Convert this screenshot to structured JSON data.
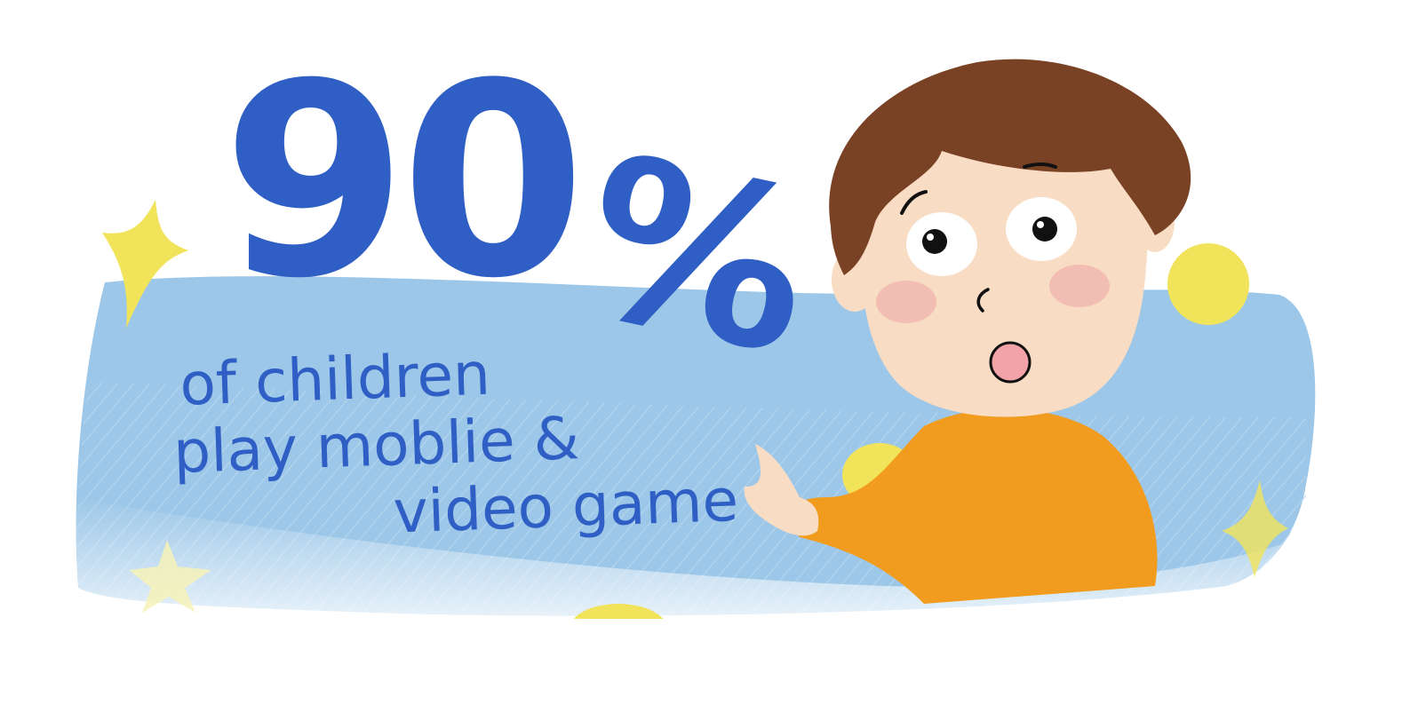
{
  "headline": {
    "value": "90",
    "symbol": "%"
  },
  "caption": {
    "line1": "of children",
    "line2": "play moblie &",
    "line3": "video game"
  },
  "colors": {
    "text": "#2f5fc4",
    "banner": "#9cc7e8",
    "hair": "#7a4224",
    "skin": "#f8dcc4",
    "cheek": "#f1b9b0",
    "shirt": "#f19c1f",
    "sparkle": "#f1e45a",
    "mouth": "#f1a3a8"
  },
  "icons": [
    "sparkle-icon",
    "star-icon",
    "dot-icon",
    "child-illustration"
  ]
}
